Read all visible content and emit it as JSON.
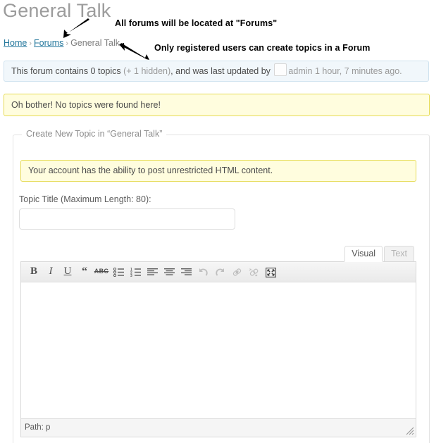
{
  "page": {
    "title": "General Talk"
  },
  "breadcrumb": {
    "home": "Home",
    "forums": "Forums",
    "current": "General Talk",
    "separator": "›"
  },
  "annotations": [
    {
      "text": "All forums will be located at \"Forums\"",
      "arrow": "arrow-down-left"
    },
    {
      "text": "Only registered users can create topics in a Forum",
      "arrow": "arrow-up-left"
    }
  ],
  "forum_info": {
    "part1": "This forum contains 0 topics ",
    "hidden": "(+ 1 hidden)",
    "part2": ", and was last updated by",
    "avatar": "avatar-placeholder-icon",
    "part3": "admin 1 hour, 7 minutes ago."
  },
  "no_topics_notice": {
    "text": "Oh bother! No topics were found here!"
  },
  "create_topic": {
    "legend": "Create New Topic in “General Talk”",
    "html_notice": "Your account has the ability to post unrestricted HTML content.",
    "title_label": "Topic Title (Maximum Length: 80):",
    "title_value": "",
    "title_placeholder": ""
  },
  "editor": {
    "tabs": [
      {
        "label": "Visual",
        "active": true
      },
      {
        "label": "Text",
        "active": false
      }
    ],
    "toolbar": [
      {
        "name": "bold-icon",
        "glyph": "B",
        "disabled": false
      },
      {
        "name": "italic-icon",
        "glyph": "I",
        "disabled": false
      },
      {
        "name": "underline-icon",
        "glyph": "U",
        "disabled": false
      },
      {
        "name": "blockquote-icon",
        "glyph": "“",
        "disabled": false
      },
      {
        "name": "strikethrough-icon",
        "glyph": "ABC",
        "disabled": false
      },
      {
        "name": "unordered-list-icon",
        "glyph": "",
        "disabled": false
      },
      {
        "name": "ordered-list-icon",
        "glyph": "",
        "disabled": false
      },
      {
        "name": "align-left-icon",
        "glyph": "",
        "disabled": false
      },
      {
        "name": "align-center-icon",
        "glyph": "",
        "disabled": false
      },
      {
        "name": "align-right-icon",
        "glyph": "",
        "disabled": false
      },
      {
        "name": "undo-icon",
        "glyph": "",
        "disabled": true
      },
      {
        "name": "redo-icon",
        "glyph": "",
        "disabled": true
      },
      {
        "name": "link-icon",
        "glyph": "",
        "disabled": true
      },
      {
        "name": "unlink-icon",
        "glyph": "",
        "disabled": true
      },
      {
        "name": "fullscreen-icon",
        "glyph": "",
        "disabled": false
      }
    ],
    "content": "",
    "status_path": "Path: p"
  },
  "colors": {
    "title_gray": "#9c9c9c",
    "link_blue": "#21759b",
    "info_bg": "#f1f7fb",
    "info_border": "#cfe2ef",
    "notice_bg": "#fffdde",
    "notice_border": "#e6db55",
    "toolbar_bg": "#eaeaea"
  }
}
